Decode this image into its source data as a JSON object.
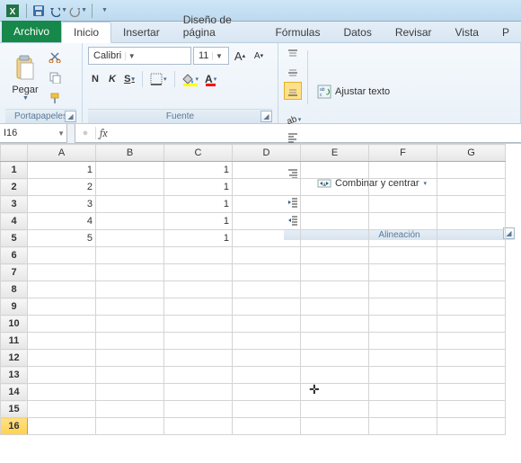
{
  "qat": {
    "excel_icon": "excel-icon",
    "save_icon": "save-icon",
    "undo_icon": "undo-icon",
    "redo_icon": "redo-icon"
  },
  "tabs": {
    "file": "Archivo",
    "items": [
      "Inicio",
      "Insertar",
      "Diseño de página",
      "Fórmulas",
      "Datos",
      "Revisar",
      "Vista",
      "P"
    ]
  },
  "ribbon": {
    "clipboard": {
      "paste": "Pegar",
      "label": "Portapapeles"
    },
    "font": {
      "name": "Calibri",
      "size": "11",
      "bold": "N",
      "italic": "K",
      "underline": "S",
      "label": "Fuente",
      "fill_color": "#ffff00",
      "font_color": "#ff0000"
    },
    "alignment": {
      "wrap": "Ajustar texto",
      "merge": "Combinar y centrar",
      "label": "Alineación"
    }
  },
  "name_box": {
    "value": "I16"
  },
  "formula_bar": {
    "value": ""
  },
  "columns": [
    "A",
    "B",
    "C",
    "D",
    "E",
    "F",
    "G"
  ],
  "rows": [
    1,
    2,
    3,
    4,
    5,
    6,
    7,
    8,
    9,
    10,
    11,
    12,
    13,
    14,
    15,
    16
  ],
  "selected_row": 16,
  "cells": {
    "A1": "1",
    "A2": "2",
    "A3": "3",
    "A4": "4",
    "A5": "5",
    "C1": "1",
    "C2": "1",
    "C3": "1",
    "C4": "1",
    "C5": "1"
  },
  "chart_data": {
    "type": "table",
    "columns": [
      "A",
      "B",
      "C",
      "D",
      "E",
      "F",
      "G"
    ],
    "rows": [
      1,
      2,
      3,
      4,
      5,
      6,
      7,
      8,
      9,
      10,
      11,
      12,
      13,
      14,
      15,
      16
    ],
    "cells": {
      "A1": 1,
      "A2": 2,
      "A3": 3,
      "A4": 4,
      "A5": 5,
      "C1": 1,
      "C2": 1,
      "C3": 1,
      "C4": 1,
      "C5": 1
    }
  }
}
